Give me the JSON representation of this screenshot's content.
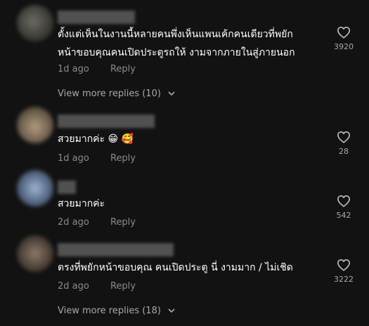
{
  "comments": [
    {
      "text_line1": "ตั้งแต่เห็นในงานนี้หลายคนพึ่งเห็นแพนเค้กคนเดียวที่พยัก",
      "text_line2": "หน้าขอบคุณคนเปิดประตูรถให้ งามจากภายในสู่ภายนอก",
      "time": "1d ago",
      "reply_label": "Reply",
      "likes": "3920",
      "view_more": "View more replies (10)"
    },
    {
      "text_line1": "สวยมากค่ะ 😁 🥰",
      "time": "1d ago",
      "reply_label": "Reply",
      "likes": "28"
    },
    {
      "text_line1": "สวยมากค่ะ",
      "time": "2d ago",
      "reply_label": "Reply",
      "likes": "542"
    },
    {
      "text_line1": "ตรงที่พยักหน้าขอบคุณ คนเปิดประตู นี่ งามมาก / ไม่เชิด",
      "time": "2d ago",
      "reply_label": "Reply",
      "likes": "3222",
      "view_more": "View more replies (18)"
    }
  ],
  "colors": {
    "background": "#121212",
    "text": "#ffffff",
    "secondary": "#8a8a8a"
  }
}
